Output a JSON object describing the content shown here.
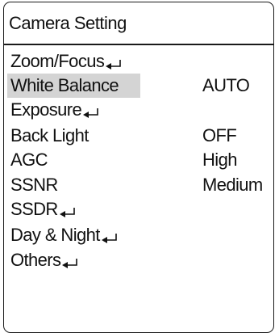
{
  "menu": {
    "title": "Camera Setting",
    "items": [
      {
        "label": "Zoom/Focus",
        "value": "",
        "submenu": true,
        "selected": false
      },
      {
        "label": "White Balance",
        "value": "AUTO",
        "submenu": false,
        "selected": true
      },
      {
        "label": "Exposure",
        "value": "",
        "submenu": true,
        "selected": false
      },
      {
        "label": "Back Light",
        "value": "OFF",
        "submenu": false,
        "selected": false
      },
      {
        "label": "AGC",
        "value": "High",
        "submenu": false,
        "selected": false
      },
      {
        "label": "SSNR",
        "value": "Medium",
        "submenu": false,
        "selected": false
      },
      {
        "label": "SSDR",
        "value": "",
        "submenu": true,
        "selected": false
      },
      {
        "label": "Day & Night",
        "value": "",
        "submenu": true,
        "selected": false
      },
      {
        "label": "Others",
        "value": "",
        "submenu": true,
        "selected": false
      }
    ]
  },
  "icons": {
    "submenu_icon": "enter-return-icon"
  },
  "colors": {
    "selection_highlight": "#d4d4d4",
    "border": "#1a1a1a",
    "text": "#111111"
  }
}
